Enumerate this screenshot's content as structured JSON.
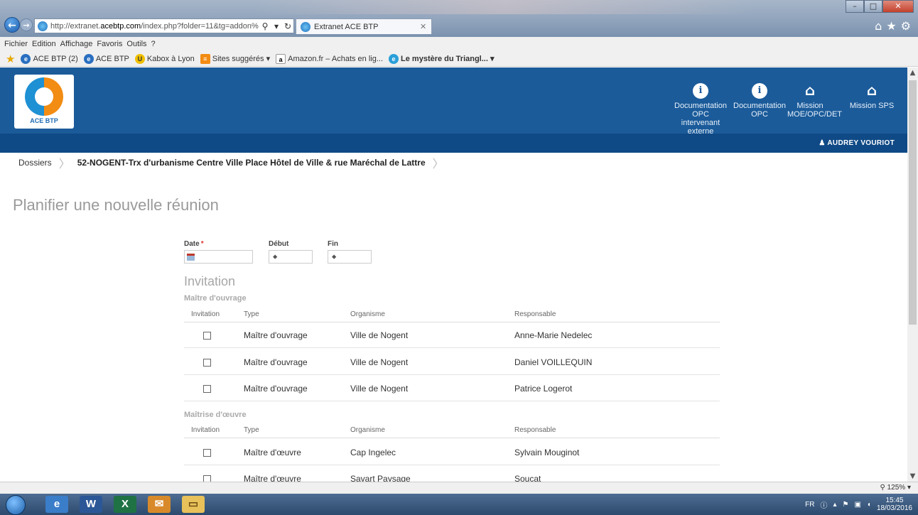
{
  "browser": {
    "url_prefix": "http://extranet.",
    "url_domain": "acebtp.com",
    "url_path": "/index.php?folder=11&tg=addon%",
    "tab_title": "Extranet ACE BTP",
    "menu": [
      "Fichier",
      "Edition",
      "Affichage",
      "Favoris",
      "Outils",
      "?"
    ],
    "favorites": [
      {
        "label": "ACE BTP (2)"
      },
      {
        "label": "ACE BTP"
      },
      {
        "label": "Kabox à Lyon"
      },
      {
        "label": "Sites suggérés ▾"
      },
      {
        "label": "Amazon.fr – Achats en lig..."
      },
      {
        "label": "Le mystère du Triangl... ▾",
        "bold": true
      }
    ],
    "zoom": "125%"
  },
  "header": {
    "logo_text": "ACE BTP",
    "links": [
      {
        "label": "Documentation OPC intervenant externe",
        "icon": "info-icon"
      },
      {
        "label": "Documentation OPC",
        "icon": "info-icon"
      },
      {
        "label": "Mission MOE/OPC/DET",
        "icon": "home-icon"
      },
      {
        "label": "Mission SPS",
        "icon": "home-icon"
      }
    ],
    "user": "AUDREY VOURIOT"
  },
  "breadcrumb": {
    "root": "Dossiers",
    "current": "52-NOGENT-Trx d'urbanisme Centre Ville Place Hôtel de Ville & rue Maréchal de Lattre"
  },
  "page_title": "Planifier une nouvelle réunion",
  "form": {
    "date_label": "Date",
    "required_mark": "*",
    "debut_label": "Début",
    "fin_label": "Fin",
    "debut_value": "⬥",
    "fin_value": "⬥"
  },
  "invitation": {
    "title": "Invitation",
    "columns": [
      "Invitation",
      "Type",
      "Organisme",
      "Responsable"
    ],
    "groups": [
      {
        "title": "Maître d'ouvrage",
        "rows": [
          {
            "type": "Maître d'ouvrage",
            "organisme": "Ville de Nogent",
            "responsable": "Anne-Marie Nedelec"
          },
          {
            "type": "Maître d'ouvrage",
            "organisme": "Ville de Nogent",
            "responsable": "Daniel VOILLEQUIN"
          },
          {
            "type": "Maître d'ouvrage",
            "organisme": "Ville de Nogent",
            "responsable": "Patrice Logerot"
          }
        ]
      },
      {
        "title": "Maîtrise d'œuvre",
        "rows": [
          {
            "type": "Maître d'œuvre",
            "organisme": "Cap Ingelec",
            "responsable": "Sylvain Mouginot"
          },
          {
            "type": "Maître d'œuvre",
            "organisme": "Savart Paysage",
            "responsable": "Soucat"
          }
        ]
      }
    ]
  },
  "taskbar": {
    "lang": "FR",
    "time": "15:45",
    "date": "18/03/2016"
  }
}
